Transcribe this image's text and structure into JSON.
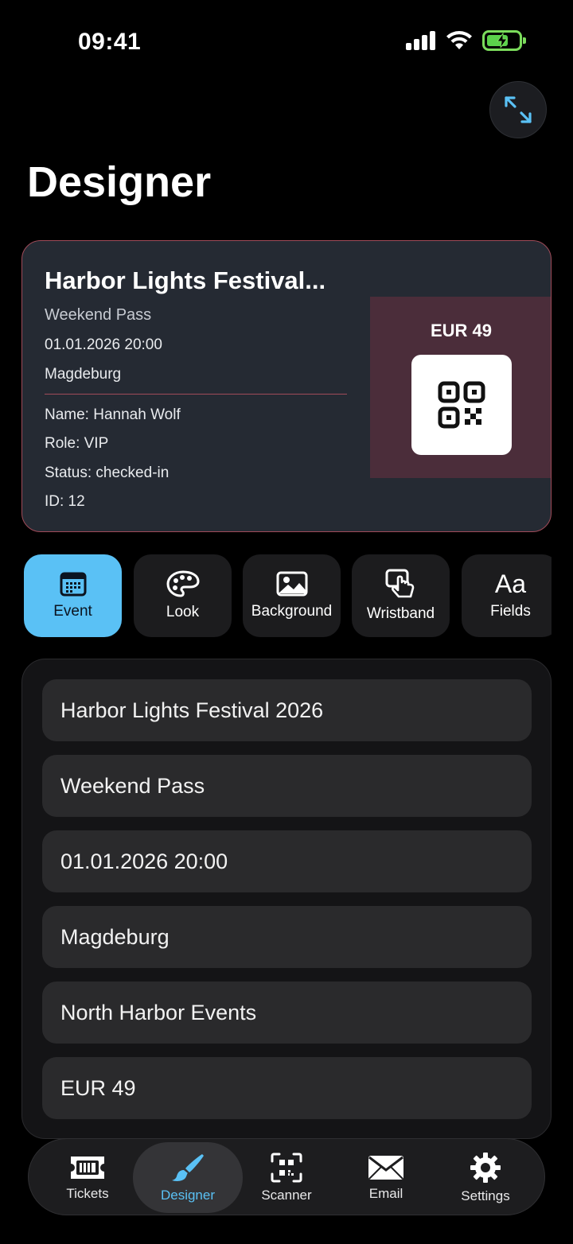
{
  "status_bar": {
    "time": "09:41"
  },
  "header": {
    "title": "Designer"
  },
  "ticket": {
    "title": "Harbor Lights Festival...",
    "subtitle": "Weekend Pass",
    "datetime": "01.01.2026 20:00",
    "city": "Magdeburg",
    "name": "Name: Hannah Wolf",
    "role": "Role: VIP",
    "status": "Status: checked-in",
    "id": "ID: 12",
    "price": "EUR 49",
    "border_color": "#a04b59",
    "side_color": "#4b2d3a"
  },
  "tabs": [
    {
      "label": "Event",
      "icon": "calendar-icon",
      "active": true
    },
    {
      "label": "Look",
      "icon": "palette-icon",
      "active": false
    },
    {
      "label": "Background",
      "icon": "image-icon",
      "active": false
    },
    {
      "label": "Wristband",
      "icon": "tap-icon",
      "active": false
    },
    {
      "label": "Fields",
      "icon": "text-aa-icon",
      "glyph": "Aa",
      "active": false
    }
  ],
  "form": {
    "fields": [
      {
        "value": "Harbor Lights Festival 2026"
      },
      {
        "value": "Weekend Pass"
      },
      {
        "value": "01.01.2026 20:00"
      },
      {
        "value": "Magdeburg"
      },
      {
        "value": "North Harbor Events"
      },
      {
        "value": "EUR 49"
      }
    ]
  },
  "bottom_nav": [
    {
      "label": "Tickets",
      "icon": "ticket-icon",
      "active": false
    },
    {
      "label": "Designer",
      "icon": "brush-icon",
      "active": true
    },
    {
      "label": "Scanner",
      "icon": "qr-scan-icon",
      "active": false
    },
    {
      "label": "Email",
      "icon": "envelope-icon",
      "active": false
    },
    {
      "label": "Settings",
      "icon": "gear-icon",
      "active": false
    }
  ],
  "colors": {
    "accent": "#5ac1f5",
    "background": "#000000",
    "battery": "#5bd14b"
  }
}
